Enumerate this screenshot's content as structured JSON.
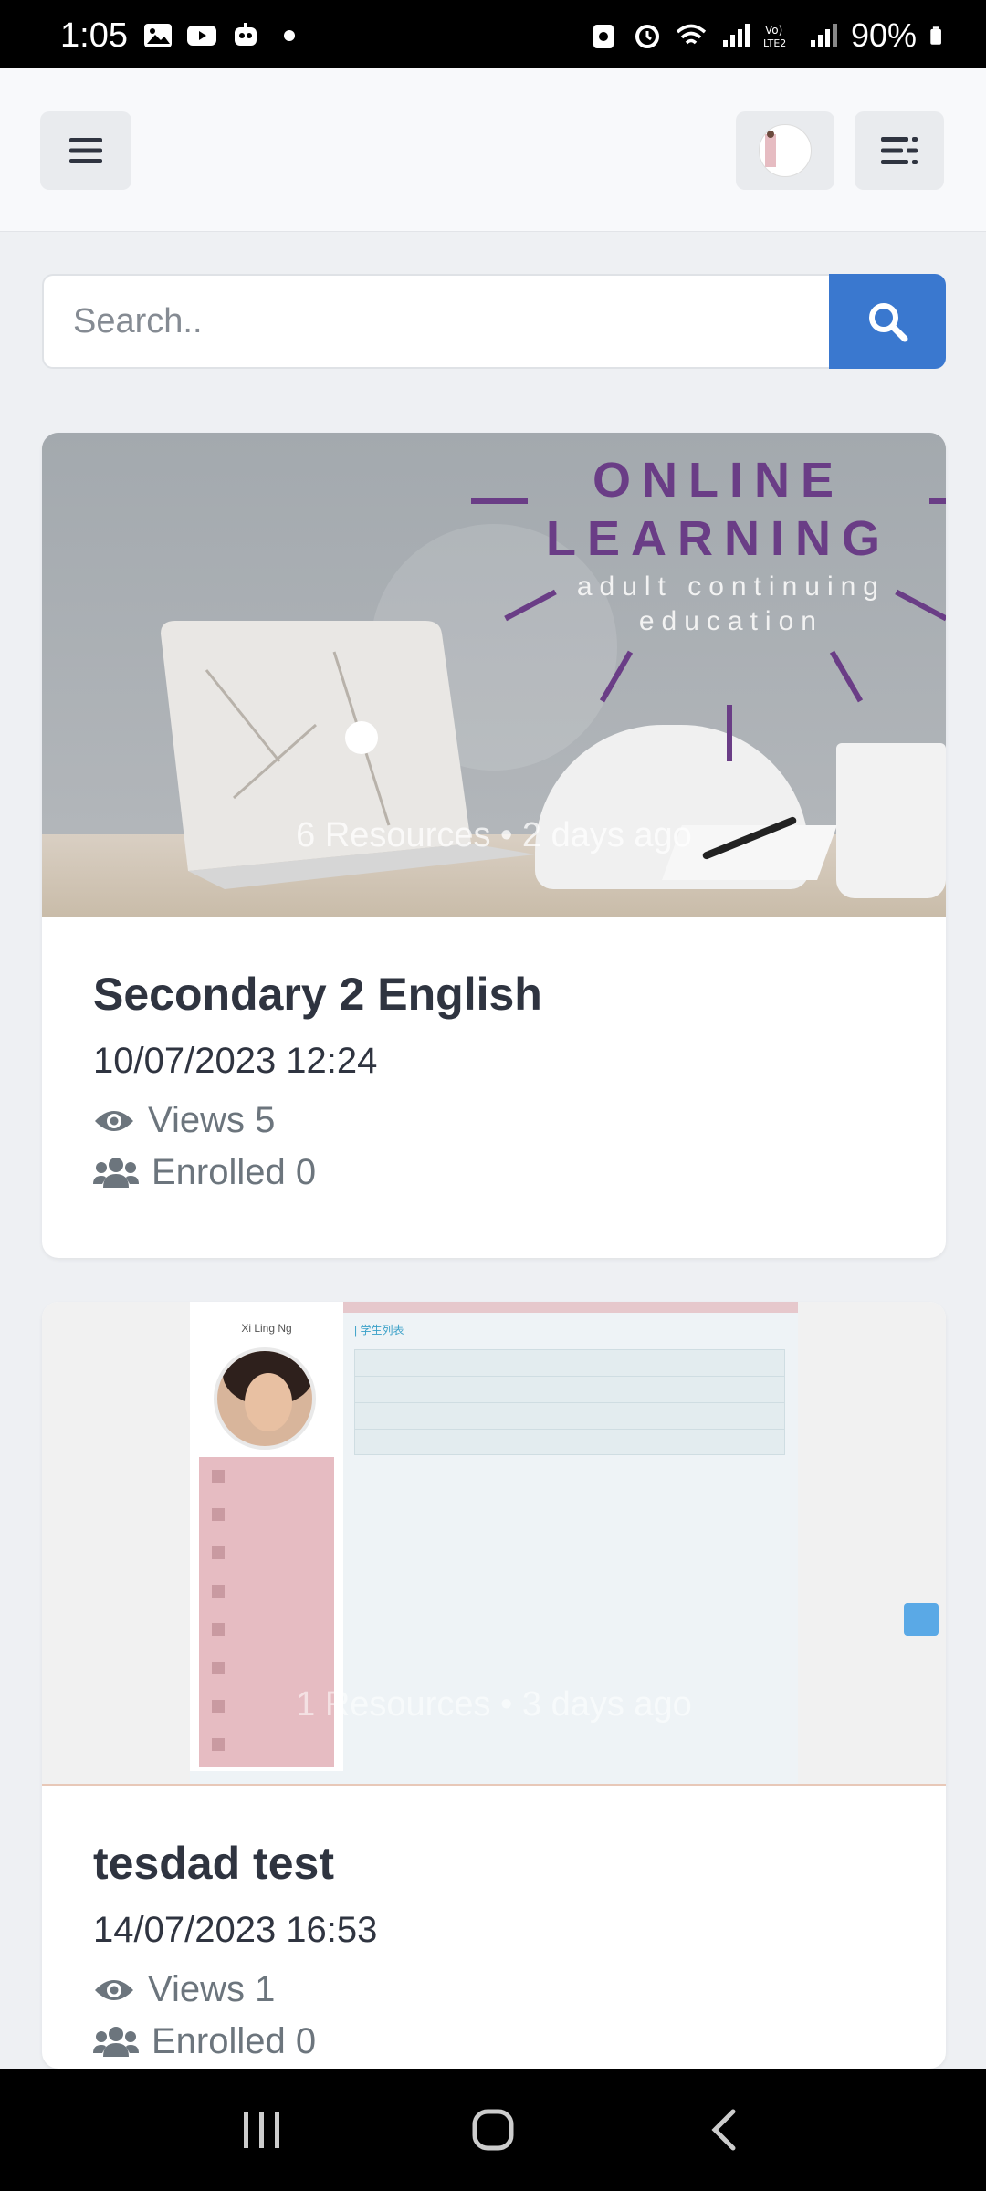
{
  "status_bar": {
    "time": "1:05",
    "battery": "90%",
    "icons_left": [
      "gallery-icon",
      "youtube-icon",
      "bot-icon",
      "dot-icon"
    ],
    "icons_right": [
      "nfc-icon",
      "alarm-icon",
      "wifi-icon",
      "signal-icon",
      "volte-icon",
      "signal2-icon",
      "battery-icon"
    ]
  },
  "header": {
    "menu_icon": "hamburger-icon",
    "avatar_icon": "user-avatar",
    "more_icon": "list-menu-icon"
  },
  "search": {
    "placeholder": "Search..",
    "value": "",
    "button_icon": "search-icon"
  },
  "cards": [
    {
      "image_title_line1": "ONLINE",
      "image_title_line2": "LEARNING",
      "image_subtitle_line1": "adult continuing",
      "image_subtitle_line2": "education",
      "overlay": "6 Resources • 2 days ago",
      "title": "Secondary 2 English",
      "date": "10/07/2023 12:24",
      "views": "Views 5",
      "enrolled": "Enrolled 0"
    },
    {
      "overlay": "1 Resources • 3 days ago",
      "title": "tesdad test",
      "date": "14/07/2023 16:53",
      "views": "Views 1",
      "enrolled": "Enrolled 0",
      "mock_name": "Xi Ling Ng",
      "mock_heading": "| 学生列表"
    }
  ],
  "colors": {
    "accent": "#3a78cf",
    "brand_purple": "#6a3d86",
    "background": "#eef0f3"
  }
}
